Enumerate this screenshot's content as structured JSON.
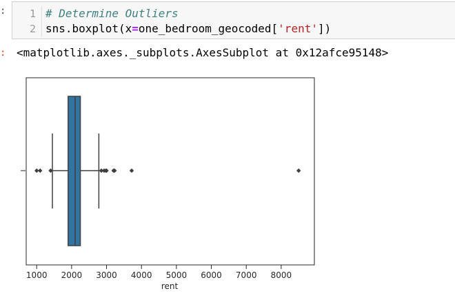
{
  "input_prompt": ":",
  "output_prompt": ":",
  "code_cell": {
    "line_numbers": [
      "1",
      "2"
    ],
    "comment": "# Determine Outliers",
    "call_prefix": "sns.boxplot(x",
    "assign_op": "=",
    "call_arg": "one_bedroom_geocoded[",
    "string_arg": "'rent'",
    "call_suffix": "])"
  },
  "output_text": "<matplotlib.axes._subplots.AxesSubplot at 0x12afce95148>",
  "chart_data": {
    "type": "box",
    "xlabel": "rent",
    "ylabel": "",
    "xlim": [
      700,
      8950
    ],
    "x_ticks": [
      1000,
      2000,
      3000,
      4000,
      5000,
      6000,
      7000,
      8000
    ],
    "grid": false,
    "box_color": "#3274a1",
    "line_color": "#3f3f3f",
    "box": {
      "whisker_low": 1450,
      "q1": 1900,
      "median": 2100,
      "q3": 2250,
      "whisker_high": 2780
    },
    "outliers": [
      1000,
      1100,
      1400,
      2850,
      2930,
      2980,
      3000,
      3200,
      3230,
      3720,
      8500
    ]
  }
}
